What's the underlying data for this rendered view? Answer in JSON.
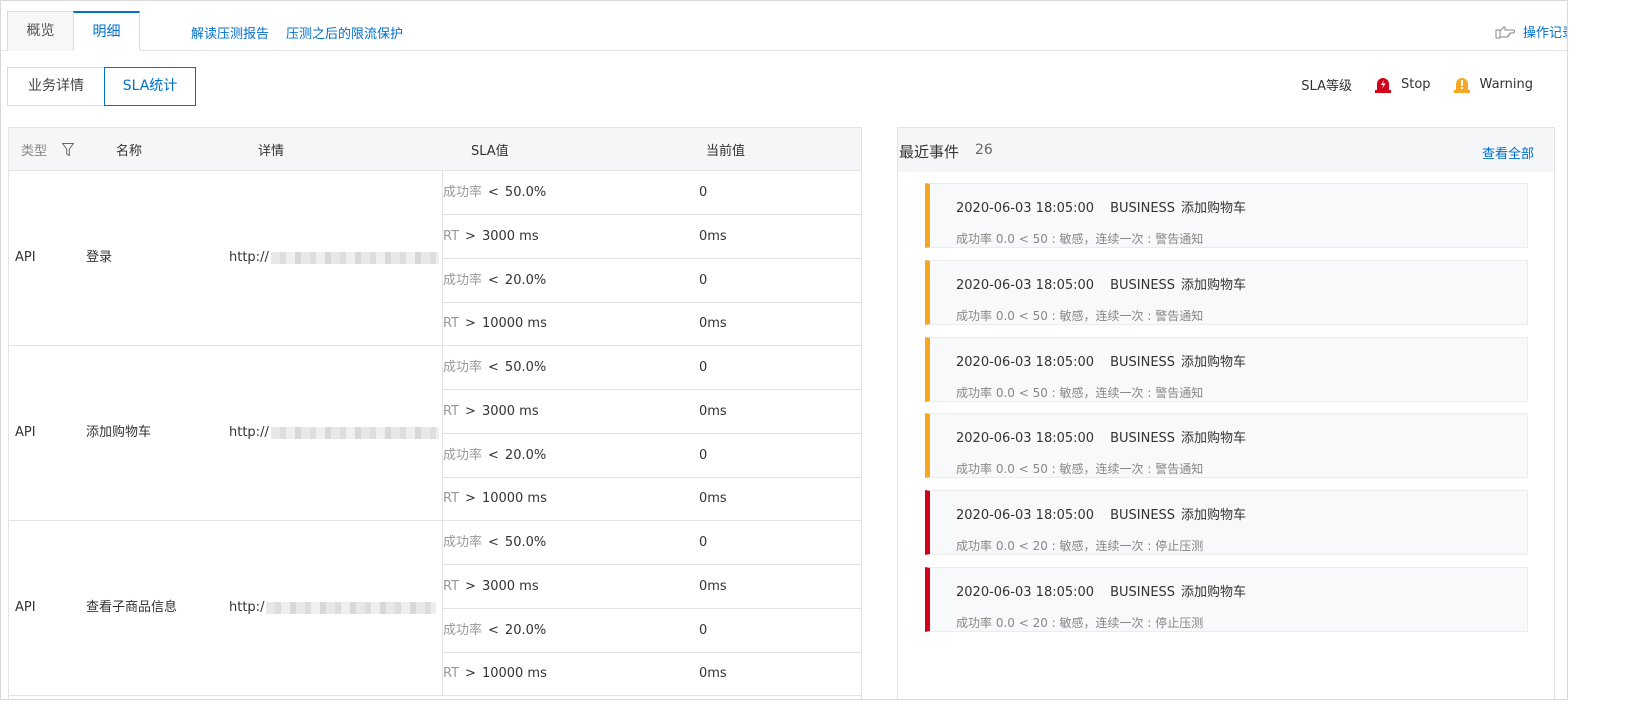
{
  "top_tabs": [
    {
      "label": "概览",
      "active": false
    },
    {
      "label": "明细",
      "active": true
    }
  ],
  "top_links": {
    "read_report": "解读压测报告",
    "rate_limit": "压测之后的限流保护",
    "operation_log": "操作记录"
  },
  "sub_tabs": [
    {
      "label": "业务详情",
      "active": false
    },
    {
      "label": "SLA统计",
      "active": true
    }
  ],
  "legend": {
    "label": "SLA等级",
    "stop": "Stop",
    "warning": "Warning",
    "stop_color": "#d0021b",
    "warning_color": "#f5a623"
  },
  "table": {
    "headers": {
      "type": "类型",
      "name": "名称",
      "detail": "详情",
      "sla": "SLA值",
      "current": "当前值"
    },
    "groups": [
      {
        "type": "API",
        "name": "登录",
        "url_prefix": "http://",
        "url_suffix": "..",
        "rows": [
          {
            "metric": "成功率",
            "op": "<",
            "value": "50.0%",
            "current": "0"
          },
          {
            "metric": "RT",
            "op": ">",
            "value": "3000 ms",
            "current": "0ms"
          },
          {
            "metric": "成功率",
            "op": "<",
            "value": "20.0%",
            "current": "0"
          },
          {
            "metric": "RT",
            "op": ">",
            "value": "10000 ms",
            "current": "0ms"
          }
        ]
      },
      {
        "type": "API",
        "name": "添加购物车",
        "url_prefix": "http://",
        "url_suffix": "",
        "rows": [
          {
            "metric": "成功率",
            "op": "<",
            "value": "50.0%",
            "current": "0"
          },
          {
            "metric": "RT",
            "op": ">",
            "value": "3000 ms",
            "current": "0ms"
          },
          {
            "metric": "成功率",
            "op": "<",
            "value": "20.0%",
            "current": "0"
          },
          {
            "metric": "RT",
            "op": ">",
            "value": "10000 ms",
            "current": "0ms"
          }
        ]
      },
      {
        "type": "API",
        "name": "查看子商品信息",
        "url_prefix": "http:/",
        "url_suffix": "",
        "rows": [
          {
            "metric": "成功率",
            "op": "<",
            "value": "50.0%",
            "current": "0"
          },
          {
            "metric": "RT",
            "op": ">",
            "value": "3000 ms",
            "current": "0ms"
          },
          {
            "metric": "成功率",
            "op": "<",
            "value": "20.0%",
            "current": "0"
          },
          {
            "metric": "RT",
            "op": ">",
            "value": "10000 ms",
            "current": "0ms"
          }
        ]
      }
    ]
  },
  "events": {
    "title": "最近事件",
    "count": "26",
    "view_all": "查看全部",
    "items": [
      {
        "time": "2020-06-03 18:05:00",
        "scope": "BUSINESS",
        "api": "添加购物车",
        "desc": "成功率 0.0 < 50 : 敏感，连续一次 : 警告通知",
        "level": "warning"
      },
      {
        "time": "2020-06-03 18:05:00",
        "scope": "BUSINESS",
        "api": "添加购物车",
        "desc": "成功率 0.0 < 50 : 敏感，连续一次 : 警告通知",
        "level": "warning"
      },
      {
        "time": "2020-06-03 18:05:00",
        "scope": "BUSINESS",
        "api": "添加购物车",
        "desc": "成功率 0.0 < 50 : 敏感，连续一次 : 警告通知",
        "level": "warning"
      },
      {
        "time": "2020-06-03 18:05:00",
        "scope": "BUSINESS",
        "api": "添加购物车",
        "desc": "成功率 0.0 < 50 : 敏感，连续一次 : 警告通知",
        "level": "warning"
      },
      {
        "time": "2020-06-03 18:05:00",
        "scope": "BUSINESS",
        "api": "添加购物车",
        "desc": "成功率 0.0 < 20 : 敏感，连续一次 : 停止压测",
        "level": "stop"
      },
      {
        "time": "2020-06-03 18:05:00",
        "scope": "BUSINESS",
        "api": "添加购物车",
        "desc": "成功率 0.0 < 20 : 敏感，连续一次 : 停止压测",
        "level": "stop"
      }
    ]
  }
}
